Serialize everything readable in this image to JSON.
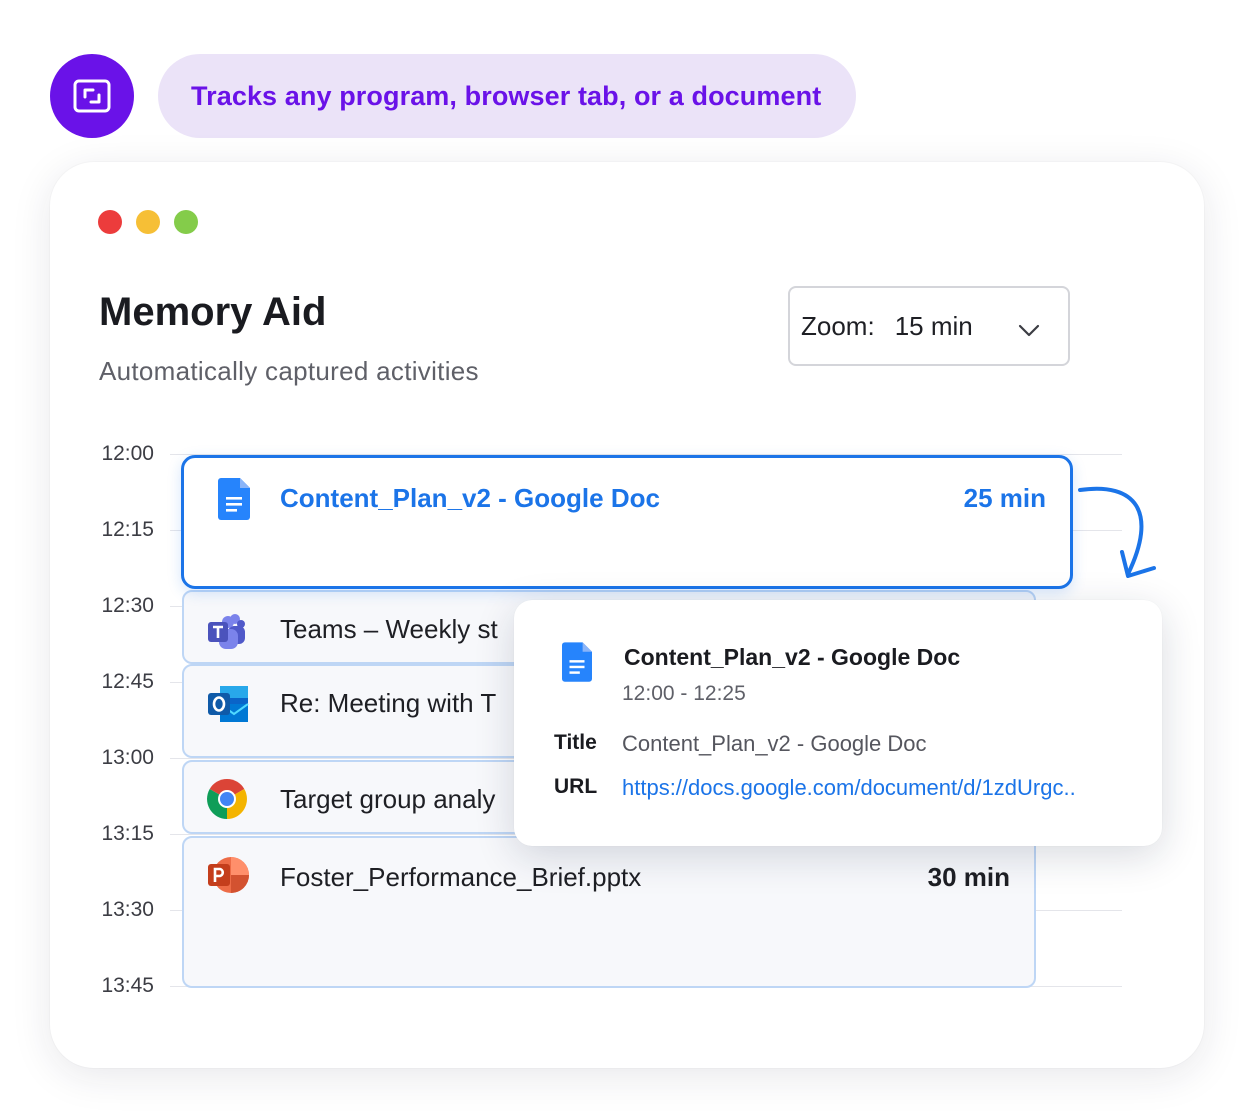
{
  "feature": {
    "icon": "screen-focus-icon",
    "text": "Tracks any program, browser tab, or a document"
  },
  "window": {
    "title": "Memory Aid",
    "subtitle": "Automatically captured activities",
    "zoom": {
      "label": "Zoom:",
      "value": "15 min"
    }
  },
  "timeline": {
    "times": [
      "12:00",
      "12:15",
      "12:30",
      "12:45",
      "13:00",
      "13:15",
      "13:30",
      "13:45"
    ],
    "events": [
      {
        "icon": "google-docs-icon",
        "title": "Content_Plan_v2 - Google Doc",
        "duration": "25 min",
        "selected": true
      },
      {
        "icon": "microsoft-teams-icon",
        "title": "Teams – Weekly st",
        "duration": ""
      },
      {
        "icon": "outlook-icon",
        "title": "Re: Meeting with T",
        "duration": ""
      },
      {
        "icon": "chrome-icon",
        "title": "Target group analy",
        "duration": ""
      },
      {
        "icon": "powerpoint-icon",
        "title": "Foster_Performance_Brief.pptx",
        "duration": "30 min"
      }
    ]
  },
  "popover": {
    "icon": "google-docs-icon",
    "title": "Content_Plan_v2 - Google Doc",
    "time_range": "12:00 - 12:25",
    "title_label": "Title",
    "title_value": "Content_Plan_v2 - Google Doc",
    "url_label": "URL",
    "url_value": "https://docs.google.com/document/d/1zdUrgc.."
  },
  "colors": {
    "brand": "#6a12e8",
    "brand_tint": "#ebe3f8",
    "accent": "#1b74e8",
    "traffic_red": "#ec3c3c",
    "traffic_yellow": "#f6bf36",
    "traffic_green": "#84cc4a"
  }
}
